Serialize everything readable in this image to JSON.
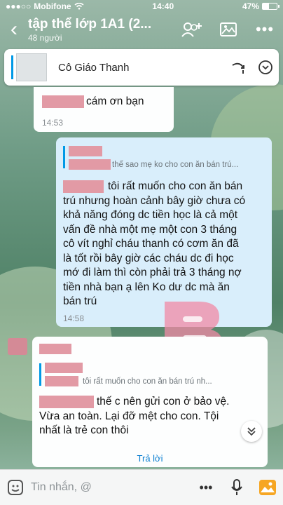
{
  "status": {
    "carrier": "Mobifone",
    "time": "14:40",
    "battery": "47%",
    "battery_level": 0.47
  },
  "header": {
    "title": "tập thể lớp 1A1 (2...",
    "subtitle": "48 người",
    "icons": [
      "back-icon",
      "add-member-icon",
      "gallery-icon",
      "more-icon"
    ]
  },
  "pinned": {
    "name": "Cô Giáo Thanh",
    "icons": [
      "reply-arrow-icon",
      "chevron-down-icon"
    ]
  },
  "messages": {
    "m1": {
      "text": "cám ơn bạn",
      "time": "14:53"
    },
    "m2": {
      "quote": "thế sao mẹ ko cho con ăn bán trú...",
      "lines": [
        "tôi rất muốn cho con ăn bán",
        "trú nhưng hoàn cảnh bây giờ chưa có",
        "khả năng đóng dc tiền học là cả một",
        "vấn đề nhà một mẹ một con 3 tháng",
        "cô vít nghỉ cháu thanh có cơm ăn đã",
        "là tốt rồi bây giờ các cháu dc đi học",
        "mớ đi làm thì còn phải trả 3 tháng nợ",
        "tiền nhà bạn ạ lên Ko dư dc mà ăn",
        "bán trú"
      ],
      "time": "14:58"
    },
    "m3": {
      "quote": "tôi rất muốn cho con ăn bán trú nh...",
      "lines": [
        "thế c nên gửi con ở bảo vệ.",
        "Vừa an toàn. Lại đỡ mệt cho con. Tội",
        "nhất là trẻ con thôi"
      ],
      "reply_label": "Trả lời"
    }
  },
  "composer": {
    "placeholder": "Tin nhắn, @",
    "icons": [
      "sticker-icon",
      "more-icon",
      "microphone-icon",
      "image-icon"
    ]
  },
  "colors": {
    "accent": "#0099e6",
    "redaction": "#e29aa5",
    "bubble_blue": "#d9eefb"
  }
}
